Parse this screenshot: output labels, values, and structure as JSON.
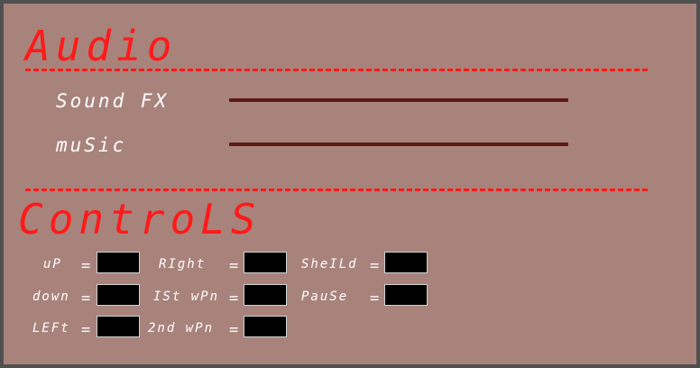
{
  "audio": {
    "title": "Audio",
    "sliders": [
      {
        "label": "Sound FX"
      },
      {
        "label": "muSic"
      }
    ]
  },
  "controls": {
    "title": "ControLS",
    "bindings": [
      {
        "label": "uP",
        "value": ""
      },
      {
        "label": "RIght",
        "value": ""
      },
      {
        "label": "SheILd",
        "value": ""
      },
      {
        "label": "down",
        "value": ""
      },
      {
        "label": "ISt wPn",
        "value": ""
      },
      {
        "label": "PauSe",
        "value": ""
      },
      {
        "label": "LEFt",
        "value": ""
      },
      {
        "label": "2nd wPn",
        "value": ""
      }
    ],
    "equals": "="
  },
  "colors": {
    "background": "#a8837c",
    "heading": "#ff1a1a",
    "track": "#5c1a12",
    "text": "#ffffff",
    "keybox": "#000000"
  }
}
